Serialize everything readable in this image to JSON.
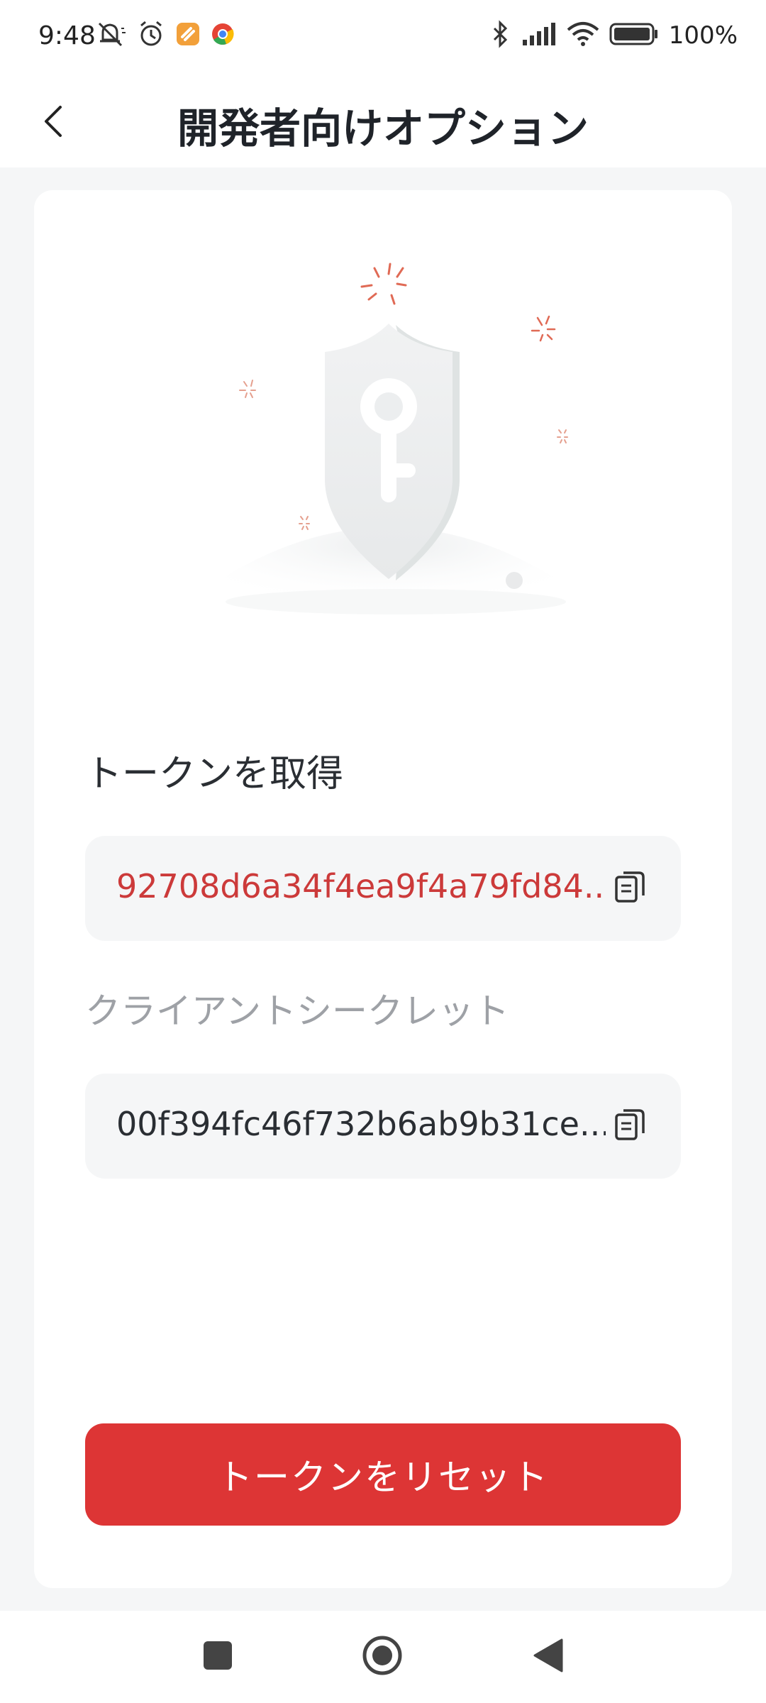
{
  "status_bar": {
    "time": "9:48",
    "battery_text": "100%",
    "icons_left": [
      "mute-icon",
      "alarm-icon",
      "app-notification-icon",
      "chrome-icon"
    ],
    "icons_right": [
      "bluetooth-icon",
      "signal-icon",
      "wifi-icon",
      "battery-icon"
    ]
  },
  "header": {
    "title": "開発者向けオプション",
    "back_icon": "chevron-left-icon"
  },
  "token_section": {
    "label": "トークンを取得",
    "value": "92708d6a34f4ea9f4a79fd84...",
    "value_color": "#cc3a3a"
  },
  "secret_section": {
    "label": "クライアントシークレット",
    "value": "00f394fc46f732b6ab9b31ce..."
  },
  "reset_button": {
    "label": "トークンをリセット",
    "color": "#dd3535"
  },
  "navbar": {
    "icons": [
      "recents-square-icon",
      "home-circle-icon",
      "back-triangle-icon"
    ]
  }
}
